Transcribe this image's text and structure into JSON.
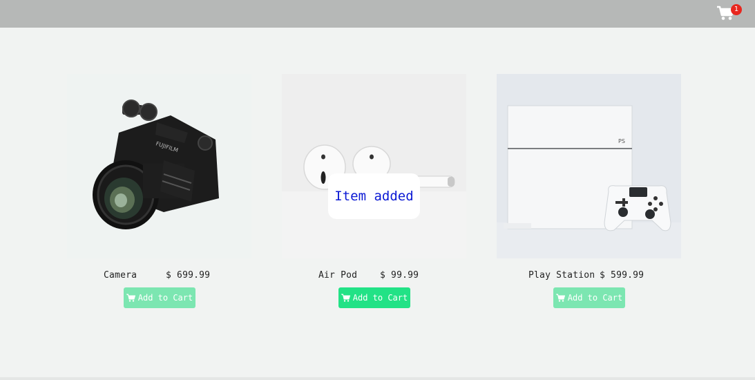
{
  "header": {
    "cart_count": "1",
    "cart_icon": "shopping-cart-icon"
  },
  "products": [
    {
      "name": "Camera",
      "price": "$ 699.99",
      "button_label": "Add to Cart",
      "image": "camera-photo"
    },
    {
      "name": "Air Pod",
      "price": "$ 99.99",
      "button_label": "Add to Cart",
      "image": "airpods-photo"
    },
    {
      "name": "Play Station",
      "price": "$ 599.99",
      "button_label": "Add to Cart",
      "image": "playstation-photo"
    }
  ],
  "toast": {
    "message": "Item added"
  },
  "colors": {
    "topbar": "#b6b8b7",
    "badge": "#e8261e",
    "button_faded": "#7ce6b1",
    "button_active": "#22e286",
    "toast_text": "#0a18d4"
  }
}
